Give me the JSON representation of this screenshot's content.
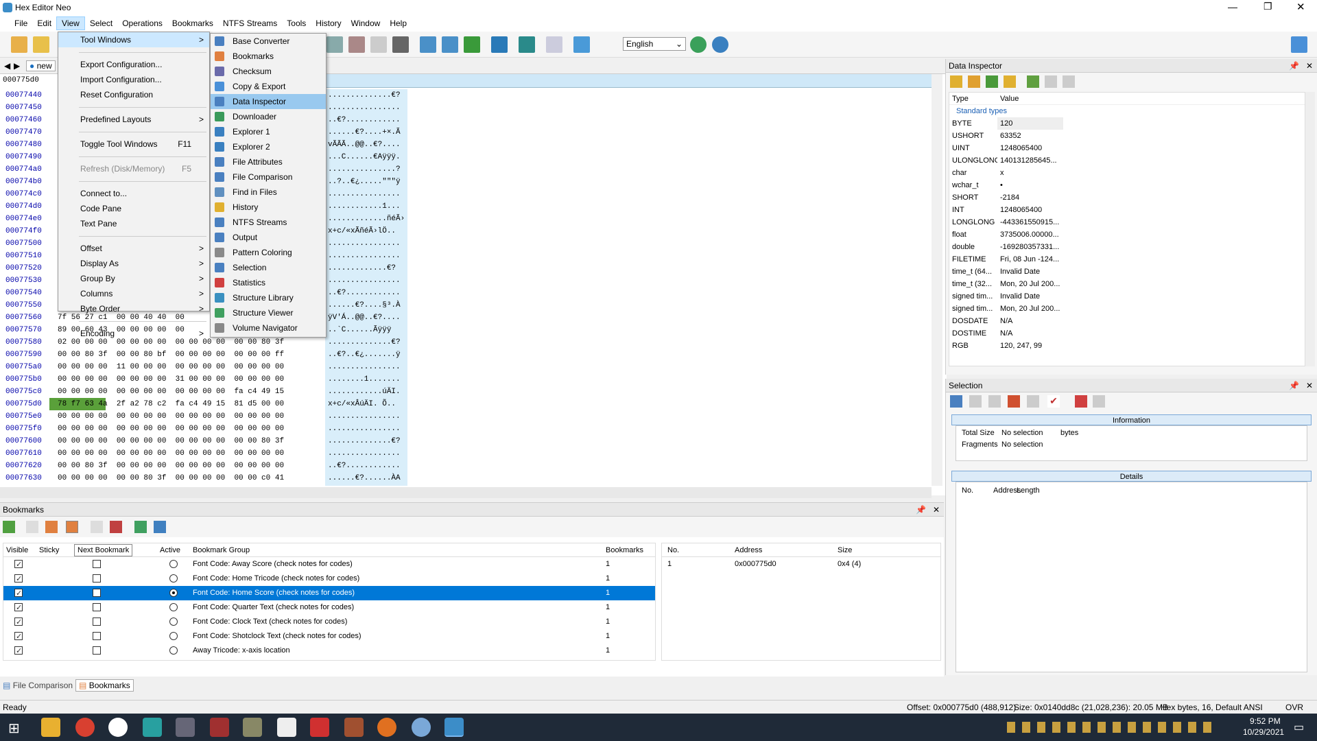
{
  "window": {
    "title": "Hex Editor Neo"
  },
  "menubar": [
    "File",
    "Edit",
    "View",
    "Select",
    "Operations",
    "Bookmarks",
    "NTFS Streams",
    "Tools",
    "History",
    "Window",
    "Help"
  ],
  "toolbar": {
    "language": "English"
  },
  "hex": {
    "tab": "new",
    "current_offset": "000775d0",
    "offsets": [
      "00077440",
      "00077450",
      "00077460",
      "00077470",
      "00077480",
      "00077490",
      "000774a0",
      "000774b0",
      "000774c0",
      "000774d0",
      "000774e0",
      "000774f0",
      "00077500",
      "00077510",
      "00077520",
      "00077530",
      "00077540",
      "00077550",
      "00077560",
      "00077570",
      "00077580",
      "00077590",
      "000775a0",
      "000775b0",
      "000775c0",
      "000775d0",
      "000775e0",
      "000775f0",
      "00077600",
      "00077610",
      "00077620",
      "00077630"
    ],
    "bytes_visible": [
      "",
      "",
      "",
      "",
      "",
      "",
      "",
      "",
      "",
      "",
      "",
      "",
      "",
      "",
      "",
      "",
      "",
      "",
      "7f 56 27 c1  00 00 40 40  00",
      "89 00 60 43  00 00 00 00  00",
      "02 00 00 00  00 00 00 00  00 00 00 00  00 00 80 3f",
      "00 00 80 3f  00 00 80 bf  00 00 00 00  00 00 00 ff",
      "00 00 00 00  11 00 00 00  00 00 00 00  00 00 00 00",
      "00 00 00 00  00 00 00 00  31 00 00 00  00 00 00 00",
      "00 00 00 00  00 00 00 00  00 00 00 00  fa c4 49 15",
      "78 f7 63 4a  2f a2 78 c2  fa c4 49 15  81 d5 00 00",
      "00 00 00 00  00 00 00 00  00 00 00 00  00 00 00 00",
      "00 00 00 00  00 00 00 00  00 00 00 00  00 00 00 00",
      "00 00 00 00  00 00 00 00  00 00 00 00  00 00 80 3f",
      "00 00 00 00  00 00 00 00  00 00 00 00  00 00 00 00",
      "00 00 80 3f  00 00 00 00  00 00 00 00  00 00 00 00",
      "00 00 00 00  00 00 80 3f  00 00 00 00  00 00 c0 41"
    ],
    "ascii": [
      "..............€?",
      "................",
      "..€?............",
      "......€?....+×.Ã",
      "vÃÃÃ..@@..€?....",
      "...C......€Aÿÿÿ.",
      "...............?",
      "..?..€¿.....\"\"\"ÿ",
      "................",
      "............1...",
      ".............ñéÃ›",
      "x+c/«xÃñéÃ›lÖ..",
      "................",
      "................",
      ".............€?",
      "................",
      "..€?............",
      "......€?....§³.À",
      "ÿV'Á..@@..€?....",
      "..`C......Ãÿÿÿ",
      "..............€?",
      "..€?..€¿.......ÿ",
      "................",
      "........1.......",
      "............úÄI.",
      "x+c/«xÂúÄI. Õ..",
      "................",
      "................",
      "..............€?",
      "................",
      "..€?............",
      "......€?......ÀA"
    ]
  },
  "view_menu": {
    "items": [
      {
        "label": "Tool Windows",
        "arrow": ">"
      },
      {
        "sep": true
      },
      {
        "label": "Export Configuration..."
      },
      {
        "label": "Import Configuration..."
      },
      {
        "label": "Reset Configuration"
      },
      {
        "sep": true
      },
      {
        "label": "Predefined Layouts",
        "arrow": ">"
      },
      {
        "sep": true
      },
      {
        "label": "Toggle Tool Windows",
        "shortcut": "F11"
      },
      {
        "sep": true
      },
      {
        "label": "Refresh (Disk/Memory)",
        "shortcut": "F5",
        "disabled": true
      },
      {
        "sep": true
      },
      {
        "label": "Connect to..."
      },
      {
        "label": "Code Pane"
      },
      {
        "label": "Text Pane"
      },
      {
        "sep": true
      },
      {
        "label": "Offset",
        "arrow": ">"
      },
      {
        "label": "Display As",
        "arrow": ">"
      },
      {
        "label": "Group By",
        "arrow": ">"
      },
      {
        "label": "Columns",
        "arrow": ">"
      },
      {
        "label": "Byte Order",
        "arrow": ">"
      },
      {
        "sep": true
      },
      {
        "label": "Encoding",
        "arrow": ">"
      }
    ]
  },
  "tool_windows_menu": [
    "Base Converter",
    "Bookmarks",
    "Checksum",
    "Copy & Export",
    "Data Inspector",
    "Downloader",
    "Explorer 1",
    "Explorer 2",
    "File Attributes",
    "File Comparison",
    "Find in Files",
    "History",
    "NTFS Streams",
    "Output",
    "Pattern Coloring",
    "Selection",
    "Statistics",
    "Structure Library",
    "Structure Viewer",
    "Volume Navigator"
  ],
  "data_inspector": {
    "title": "Data Inspector",
    "col_type": "Type",
    "col_value": "Value",
    "group": "Standard types",
    "rows": [
      [
        "BYTE",
        "120"
      ],
      [
        "USHORT",
        "63352"
      ],
      [
        "UINT",
        "1248065400"
      ],
      [
        "ULONGLONG",
        "140131285645..."
      ],
      [
        "char",
        "x"
      ],
      [
        "wchar_t",
        "•"
      ],
      [
        "SHORT",
        "-2184"
      ],
      [
        "INT",
        "1248065400"
      ],
      [
        "LONGLONG",
        "-443361550915..."
      ],
      [
        "float",
        "3735006.00000..."
      ],
      [
        "double",
        "-169280357331..."
      ],
      [
        "FILETIME",
        "Fri, 08 Jun -124..."
      ],
      [
        "time_t (64...",
        "Invalid Date"
      ],
      [
        "time_t (32...",
        "Mon, 20 Jul 200..."
      ],
      [
        "signed tim...",
        "Invalid Date"
      ],
      [
        "signed tim...",
        "Mon, 20 Jul 200..."
      ],
      [
        "DOSDATE",
        "N/A"
      ],
      [
        "DOSTIME",
        "N/A"
      ],
      [
        "RGB",
        "120, 247, 99"
      ]
    ]
  },
  "selection_panel": {
    "title": "Selection",
    "information": "Information",
    "details": "Details",
    "total_size_label": "Total Size",
    "total_size": "No selection",
    "bytes": "bytes",
    "fragments_label": "Fragments",
    "fragments": "No selection",
    "col_no": "No.",
    "col_address": "Address",
    "col_length": "Length"
  },
  "bookmarks": {
    "title": "Bookmarks",
    "tooltip": "Next Bookmark",
    "cols": {
      "visible": "Visible",
      "sticky": "Sticky",
      "active": "Active",
      "group": "Bookmark Group",
      "count": "Bookmarks"
    },
    "rows": [
      {
        "group": "Font Code: Away Score (check notes for codes)",
        "count": "1",
        "active": false
      },
      {
        "group": "Font Code: Home Tricode (check notes for codes)",
        "count": "1",
        "active": false
      },
      {
        "group": "Font Code: Home Score (check notes for codes)",
        "count": "1",
        "active": true
      },
      {
        "group": "Font Code: Quarter Text (check notes for codes)",
        "count": "1",
        "active": false
      },
      {
        "group": "Font Code: Clock Text (check notes for codes)",
        "count": "1",
        "active": false
      },
      {
        "group": "Font Code: Shotclock Text (check notes for codes)",
        "count": "1",
        "active": false
      },
      {
        "group": "Away Tricode: x-axis location",
        "count": "1",
        "active": false
      }
    ],
    "detail_cols": {
      "no": "No.",
      "address": "Address",
      "size": "Size"
    },
    "detail_row": {
      "no": "1",
      "address": "0x000775d0",
      "size": "0x4 (4)"
    }
  },
  "bottom_tabs": [
    "File Comparison",
    "Bookmarks"
  ],
  "status": {
    "left": "Ready",
    "offset": "Offset: 0x000775d0 (488,912)",
    "size": "Size: 0x0140dd8c (21,028,236): 20.05 MB",
    "mode": "Hex bytes, 16, Default ANSI",
    "ovr": "OVR"
  },
  "clock": {
    "time": "9:52 PM",
    "date": "10/29/2021"
  }
}
